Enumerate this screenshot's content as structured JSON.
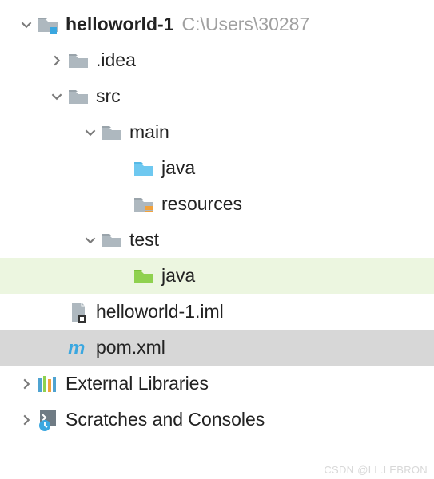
{
  "root": {
    "name": "helloworld-1",
    "path": "C:\\Users\\30287"
  },
  "nodes": {
    "idea": ".idea",
    "src": "src",
    "main": "main",
    "main_java": "java",
    "main_resources": "resources",
    "test": "test",
    "test_java": "java",
    "iml": "helloworld-1.iml",
    "pom": "pom.xml",
    "ext_lib": "External Libraries",
    "scratches": "Scratches and Consoles"
  },
  "watermark": "CSDN @LL.LEBRON"
}
